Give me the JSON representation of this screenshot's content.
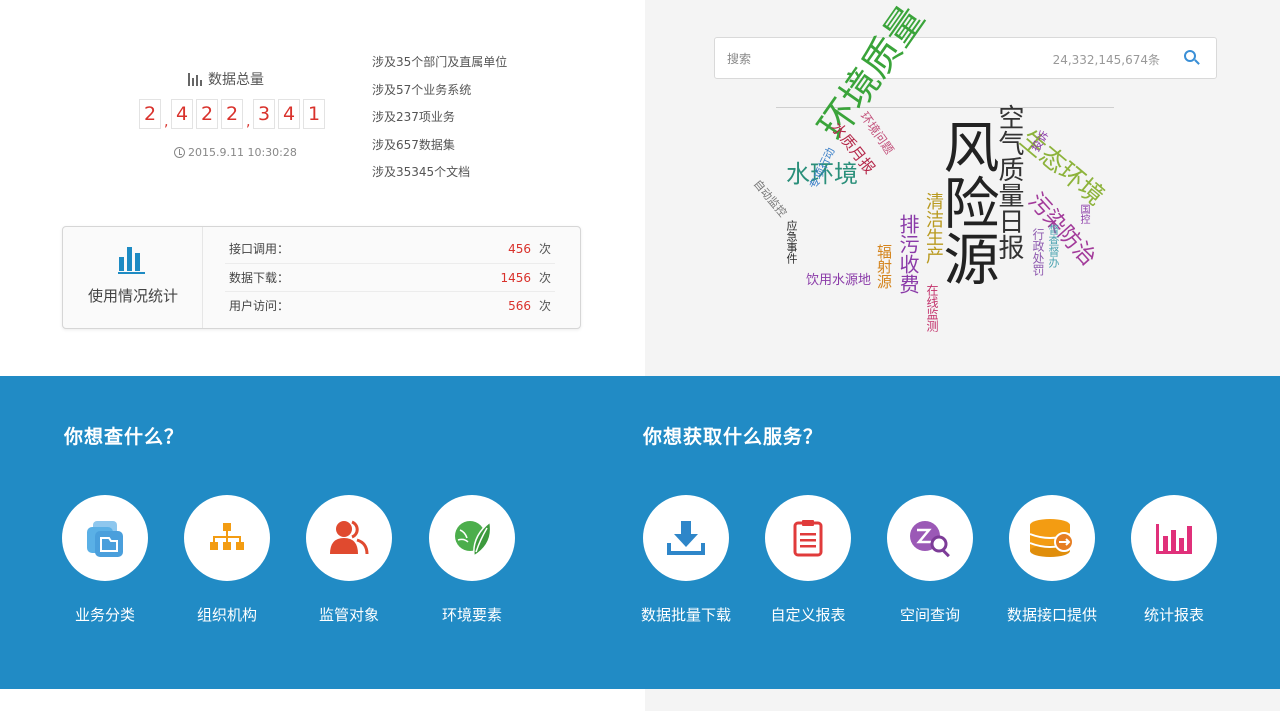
{
  "data_total": {
    "title": "数据总量",
    "digits": [
      "2",
      "4",
      "2",
      "2",
      "3",
      "4",
      "1"
    ],
    "separators": [
      ",",
      ","
    ],
    "timestamp": "2015.9.11 10:30:28"
  },
  "stats_list": [
    "涉及35个部门及直属单位",
    "涉及57个业务系统",
    "涉及237项业务",
    "涉及657数据集",
    "涉及35345个文档"
  ],
  "usage": {
    "title": "使用情况统计",
    "rows": [
      {
        "label": "接口调用：",
        "value": "456",
        "unit": "次"
      },
      {
        "label": "数据下载：",
        "value": "1456",
        "unit": "次"
      },
      {
        "label": "用户访问：",
        "value": "566",
        "unit": "次"
      }
    ]
  },
  "search": {
    "placeholder": "搜索",
    "count": "24,332,145,674条"
  },
  "word_cloud": [
    {
      "text": "风险源",
      "color": "#222222"
    },
    {
      "text": "环境质量",
      "color": "#3aa43a"
    },
    {
      "text": "水环境",
      "color": "#2a8f7a"
    },
    {
      "text": "空气质量日报",
      "color": "#333333"
    },
    {
      "text": "生态环境",
      "color": "#8db33b"
    },
    {
      "text": "污染防治",
      "color": "#a23a9a"
    },
    {
      "text": "排污收费",
      "color": "#8a3aa8"
    },
    {
      "text": "清洁生产",
      "color": "#b99a20"
    },
    {
      "text": "辐射源",
      "color": "#d4841d"
    },
    {
      "text": "饮用水源地",
      "color": "#8a3aa8"
    },
    {
      "text": "水质月报",
      "color": "#b5284a"
    },
    {
      "text": "环境问题",
      "color": "#c24f7a"
    },
    {
      "text": "自动监控",
      "color": "#777777"
    },
    {
      "text": "专项行动",
      "color": "#3a7fc8"
    },
    {
      "text": "应急事件",
      "color": "#2b2b2b"
    },
    {
      "text": "行政处罚",
      "color": "#8f5bb0"
    },
    {
      "text": "督查督办",
      "color": "#4aa3b0"
    },
    {
      "text": "在线监测",
      "color": "#c2306a"
    },
    {
      "text": "投诉",
      "color": "#8a3aa8"
    },
    {
      "text": "国控",
      "color": "#8a3aa8"
    }
  ],
  "query_section": {
    "title": "你想查什么？",
    "items": [
      {
        "label": "业务分类",
        "icon": "folders-icon"
      },
      {
        "label": "组织机构",
        "icon": "org-chart-icon"
      },
      {
        "label": "监管对象",
        "icon": "people-icon"
      },
      {
        "label": "环境要素",
        "icon": "leaf-icon"
      }
    ]
  },
  "service_section": {
    "title": "你想获取什么服务？",
    "items": [
      {
        "label": "数据批量下载",
        "icon": "download-icon"
      },
      {
        "label": "自定义报表",
        "icon": "clipboard-icon"
      },
      {
        "label": "空间查询",
        "icon": "spatial-search-icon"
      },
      {
        "label": "数据接口提供",
        "icon": "database-icon"
      },
      {
        "label": "统计报表",
        "icon": "bar-chart-icon"
      }
    ]
  },
  "colors": {
    "accent_blue": "#218bc5",
    "digit_red": "#d9322c"
  }
}
